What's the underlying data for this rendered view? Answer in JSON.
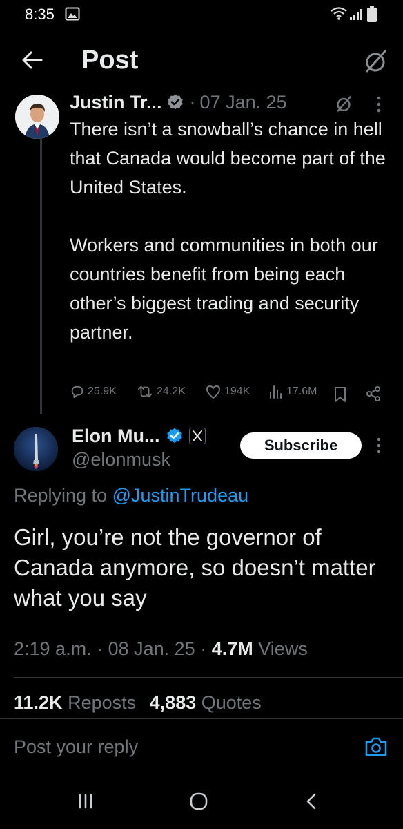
{
  "status": {
    "time": "8:35"
  },
  "header": {
    "title": "Post"
  },
  "tweet": {
    "author": "Justin Tr...",
    "sep": "·",
    "date": "07 Jan. 25",
    "para1": "There isn’t a snowball’s chance in hell that Canada would become part of the United States.",
    "para2": "Workers and communities in both our countries benefit from being each other’s biggest trading and security partner.",
    "replies": "25.9K",
    "reposts": "24.2K",
    "likes": "194K",
    "views": "17.6M"
  },
  "reply": {
    "author": "Elon Mu...",
    "handle": "@elonmusk",
    "subscribe_label": "Subscribe",
    "replying_prefix": "Replying to",
    "replying_to": "@JustinTrudeau",
    "text": "Girl, you’re not the governor of Canada anymore, so doesn’t matter what you say",
    "time": "2:19 a.m.",
    "dot1": "·",
    "date": "08 Jan. 25",
    "dot2": "·",
    "views_count": "4.7M",
    "views_label": "Views",
    "reposts_count": "11.2K",
    "reposts_label": "Reposts",
    "quotes_count": "4,883",
    "quotes_label": "Quotes"
  },
  "composer": {
    "placeholder": "Post your reply"
  },
  "colors": {
    "accent": "#1d9bf0",
    "text": "#e7e9ea",
    "muted": "#71767b",
    "background": "#000000"
  },
  "icons": [
    "back-arrow-icon",
    "grok-icon",
    "verified-icon",
    "more-icon",
    "reply-icon",
    "repost-icon",
    "like-icon",
    "views-icon",
    "bookmark-icon",
    "share-icon",
    "x-logo-icon",
    "camera-icon",
    "recent-apps-icon",
    "home-icon",
    "back-icon",
    "wifi-icon",
    "signal-icon",
    "battery-icon",
    "gallery-icon"
  ]
}
